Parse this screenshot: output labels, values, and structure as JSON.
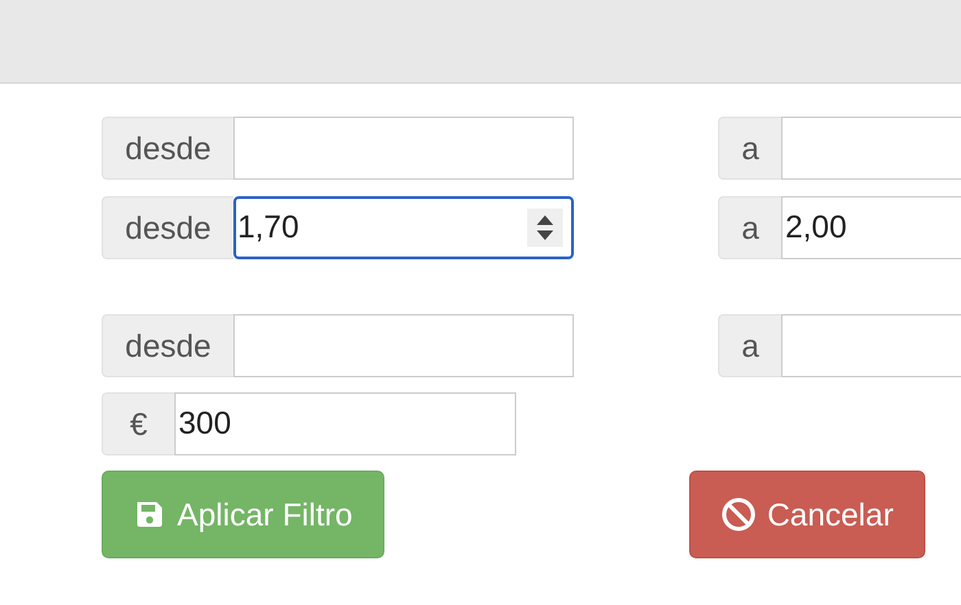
{
  "ranges": [
    {
      "from": {
        "label": "desde",
        "focused": false
      },
      "to": {
        "label": "a"
      }
    },
    {
      "from": {
        "label": "desde",
        "value": "1,70",
        "focused": true
      },
      "to": {
        "label": "a",
        "value": "2,00"
      }
    },
    {
      "from": {
        "label": "desde",
        "focused": false
      },
      "to": {
        "label": "a"
      }
    }
  ],
  "price": {
    "label": "€",
    "value": "300"
  },
  "buttons": [
    {
      "kind": "apply",
      "label": "Aplicar Filtro"
    },
    {
      "kind": "cancel",
      "label": "Cancelar"
    }
  ]
}
